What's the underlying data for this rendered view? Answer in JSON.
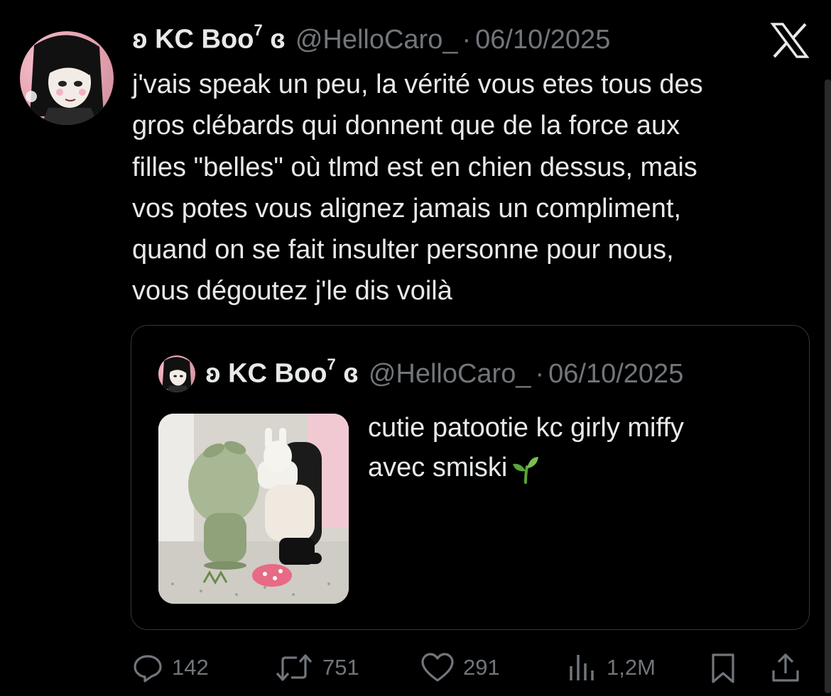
{
  "tweet": {
    "display_name": "ʚ KC Boo",
    "name_sup": "7",
    "name_suffix": " ɞ",
    "handle": "@HelloCaro_",
    "separator": "·",
    "date": "06/10/2025",
    "text_lines": [
      "j'vais speak un peu, la vérité vous etes tous des",
      "gros clébards qui donnent que de la force aux",
      "filles \"belles\" où tlmd est en chien dessus, mais",
      "vos potes vous alignez jamais un compliment,",
      "quand on se fait insulter personne pour nous,",
      "vous dégoutez j'le dis voilà"
    ]
  },
  "quoted_tweet": {
    "display_name": "ʚ KC Boo",
    "name_sup": "7",
    "name_suffix": " ɞ",
    "handle": "@HelloCaro_",
    "separator": "·",
    "date": "06/10/2025",
    "text_lines": [
      "cutie patootie kc girly miffy",
      "avec smiski"
    ],
    "emoji": "seedling-emoji"
  },
  "actions": {
    "replies": "142",
    "retweets": "751",
    "likes": "291",
    "views": "1,2M"
  },
  "icons": {
    "platform": "x-logo-icon",
    "reply": "reply-icon",
    "retweet": "retweet-icon",
    "like": "heart-icon",
    "views": "views-icon",
    "bookmark": "bookmark-icon",
    "share": "share-icon"
  },
  "colors": {
    "background": "#000000",
    "text": "#e7e9ea",
    "muted": "#71767b",
    "border": "#333639"
  }
}
